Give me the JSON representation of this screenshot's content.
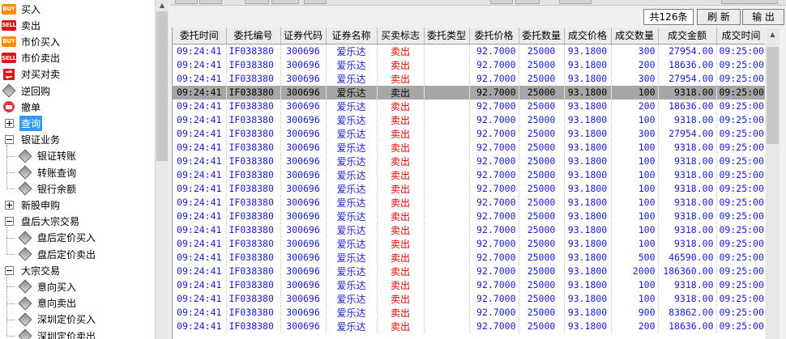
{
  "tree": [
    {
      "label": "买入",
      "icon": "buy-badge-icon",
      "badge": "BUY"
    },
    {
      "label": "卖出",
      "icon": "sell-badge-icon",
      "badge": "SELL"
    },
    {
      "label": "市价买入",
      "icon": "buy-badge-icon",
      "badge": "BUY"
    },
    {
      "label": "市价卖出",
      "icon": "sell-badge-icon",
      "badge": "SELL"
    },
    {
      "label": "对买对卖",
      "icon": "swap-icon"
    },
    {
      "label": "逆回购",
      "icon": "diamond-icon"
    },
    {
      "label": "撤单",
      "icon": "cancel-hand-icon"
    },
    {
      "label": "查询",
      "icon": "expand-plus-icon",
      "selected": true
    },
    {
      "label": "银证业务",
      "icon": "collapse-minus-icon"
    },
    {
      "label": "银证转账",
      "icon": "diamond-icon"
    },
    {
      "label": "转账查询",
      "icon": "diamond-icon"
    },
    {
      "label": "银行余额",
      "icon": "diamond-icon"
    },
    {
      "label": "新股申购",
      "icon": "expand-plus-icon"
    },
    {
      "label": "盘后大宗交易",
      "icon": "collapse-minus-icon"
    },
    {
      "label": "盘后定价买入",
      "icon": "diamond-icon"
    },
    {
      "label": "盘后定价卖出",
      "icon": "diamond-icon"
    },
    {
      "label": "大宗交易",
      "icon": "collapse-minus-icon"
    },
    {
      "label": "意向买入",
      "icon": "diamond-icon"
    },
    {
      "label": "意向卖出",
      "icon": "diamond-icon"
    },
    {
      "label": "深圳定价买入",
      "icon": "diamond-icon"
    },
    {
      "label": "深圳定价卖出",
      "icon": "diamond-icon"
    }
  ],
  "toolbar": {
    "count": "共126条",
    "refresh_label": "刷 新",
    "export_label": "输 出"
  },
  "table": {
    "columns": [
      "委托时间",
      "委托编号",
      "证券代码",
      "证券名称",
      "买卖标志",
      "委托类型",
      "委托价格",
      "委托数量",
      "成交价格",
      "成交数量",
      "成交金额",
      "成交时间"
    ],
    "rows": [
      [
        "09:24:41",
        "IF038380",
        "300696",
        "爱乐达",
        "卖出",
        "",
        "92.7000",
        "25000",
        "93.1800",
        "300",
        "27954.00",
        "09:25:00"
      ],
      [
        "09:24:41",
        "IF038380",
        "300696",
        "爱乐达",
        "卖出",
        "",
        "92.7000",
        "25000",
        "93.1800",
        "200",
        "18636.00",
        "09:25:00"
      ],
      [
        "09:24:41",
        "IF038380",
        "300696",
        "爱乐达",
        "卖出",
        "",
        "92.7000",
        "25000",
        "93.1800",
        "300",
        "27954.00",
        "09:25:00"
      ],
      [
        "09:24:41",
        "IF038380",
        "300696",
        "爱乐达",
        "卖出",
        "",
        "92.7000",
        "25000",
        "93.1800",
        "100",
        "9318.00",
        "09:25:00"
      ],
      [
        "09:24:41",
        "IF038380",
        "300696",
        "爱乐达",
        "卖出",
        "",
        "92.7000",
        "25000",
        "93.1800",
        "200",
        "18636.00",
        "09:25:00"
      ],
      [
        "09:24:41",
        "IF038380",
        "300696",
        "爱乐达",
        "卖出",
        "",
        "92.7000",
        "25000",
        "93.1800",
        "100",
        "9318.00",
        "09:25:00"
      ],
      [
        "09:24:41",
        "IF038380",
        "300696",
        "爱乐达",
        "卖出",
        "",
        "92.7000",
        "25000",
        "93.1800",
        "300",
        "27954.00",
        "09:25:00"
      ],
      [
        "09:24:41",
        "IF038380",
        "300696",
        "爱乐达",
        "卖出",
        "",
        "92.7000",
        "25000",
        "93.1800",
        "100",
        "9318.00",
        "09:25:00"
      ],
      [
        "09:24:41",
        "IF038380",
        "300696",
        "爱乐达",
        "卖出",
        "",
        "92.7000",
        "25000",
        "93.1800",
        "100",
        "9318.00",
        "09:25:00"
      ],
      [
        "09:24:41",
        "IF038380",
        "300696",
        "爱乐达",
        "卖出",
        "",
        "92.7000",
        "25000",
        "93.1800",
        "100",
        "9318.00",
        "09:25:00"
      ],
      [
        "09:24:41",
        "IF038380",
        "300696",
        "爱乐达",
        "卖出",
        "",
        "92.7000",
        "25000",
        "93.1800",
        "100",
        "9318.00",
        "09:25:00"
      ],
      [
        "09:24:41",
        "IF038380",
        "300696",
        "爱乐达",
        "卖出",
        "",
        "92.7000",
        "25000",
        "93.1800",
        "100",
        "9318.00",
        "09:25:00"
      ],
      [
        "09:24:41",
        "IF038380",
        "300696",
        "爱乐达",
        "卖出",
        "",
        "92.7000",
        "25000",
        "93.1800",
        "100",
        "9318.00",
        "09:25:00"
      ],
      [
        "09:24:41",
        "IF038380",
        "300696",
        "爱乐达",
        "卖出",
        "",
        "92.7000",
        "25000",
        "93.1800",
        "100",
        "9318.00",
        "09:25:00"
      ],
      [
        "09:24:41",
        "IF038380",
        "300696",
        "爱乐达",
        "卖出",
        "",
        "92.7000",
        "25000",
        "93.1800",
        "100",
        "9318.00",
        "09:25:00"
      ],
      [
        "09:24:41",
        "IF038380",
        "300696",
        "爱乐达",
        "卖出",
        "",
        "92.7000",
        "25000",
        "93.1800",
        "500",
        "46590.00",
        "09:25:00"
      ],
      [
        "09:24:41",
        "IF038380",
        "300696",
        "爱乐达",
        "卖出",
        "",
        "92.7000",
        "25000",
        "93.1800",
        "2000",
        "186360.00",
        "09:25:00"
      ],
      [
        "09:24:41",
        "IF038380",
        "300696",
        "爱乐达",
        "卖出",
        "",
        "92.7000",
        "25000",
        "93.1800",
        "100",
        "9318.00",
        "09:25:00"
      ],
      [
        "09:24:41",
        "IF038380",
        "300696",
        "爱乐达",
        "卖出",
        "",
        "92.7000",
        "25000",
        "93.1800",
        "100",
        "9318.00",
        "09:25:00"
      ],
      [
        "09:24:41",
        "IF038380",
        "300696",
        "爱乐达",
        "卖出",
        "",
        "92.7000",
        "25000",
        "93.1800",
        "900",
        "83862.00",
        "09:25:00"
      ],
      [
        "09:24:41",
        "IF038380",
        "300696",
        "爱乐达",
        "卖出",
        "",
        "92.7000",
        "25000",
        "93.1800",
        "200",
        "18636.00",
        "09:25:00"
      ]
    ],
    "selected_row": 3
  },
  "colors": {
    "text_blue": "#1a1acc",
    "sell_red": "#e00000",
    "selection": "#a6a6a6",
    "tree_selection": "#3399ff"
  }
}
